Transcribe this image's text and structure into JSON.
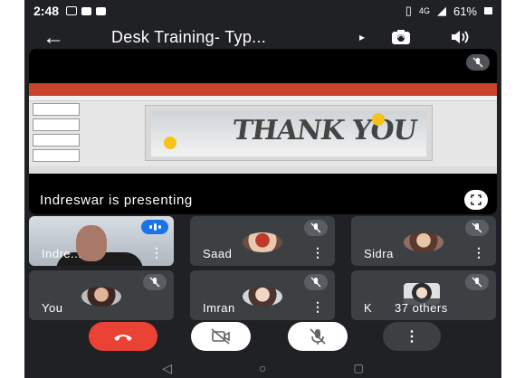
{
  "status_bar": {
    "time": "2:48",
    "network": "4G",
    "battery": "61%"
  },
  "header": {
    "title": "Desk Training- Typ...",
    "back_icon": "arrow-left-icon",
    "switch_camera_icon": "switch-camera-icon",
    "speaker_icon": "volume-icon"
  },
  "presentation": {
    "presenter_text": "Indreswar is presenting",
    "slide_text": "THANK YOU"
  },
  "participants": [
    {
      "name": "Indre...",
      "speaking": true
    },
    {
      "name": "Saad",
      "muted": true
    },
    {
      "name": "Sidra",
      "muted": true
    },
    {
      "name": "You",
      "muted": true
    },
    {
      "name": "Imran",
      "muted": true
    },
    {
      "name": "K",
      "muted": true
    }
  ],
  "others_count": "37 others",
  "controls": {
    "end_call": "end-call-icon",
    "camera": "camera-off-icon",
    "mic": "mic-off-icon",
    "more": "more-vert-icon"
  },
  "colors": {
    "background": "#202124",
    "tile": "#3c4043",
    "end_call": "#ea4335",
    "speaking": "#1a73e8"
  }
}
